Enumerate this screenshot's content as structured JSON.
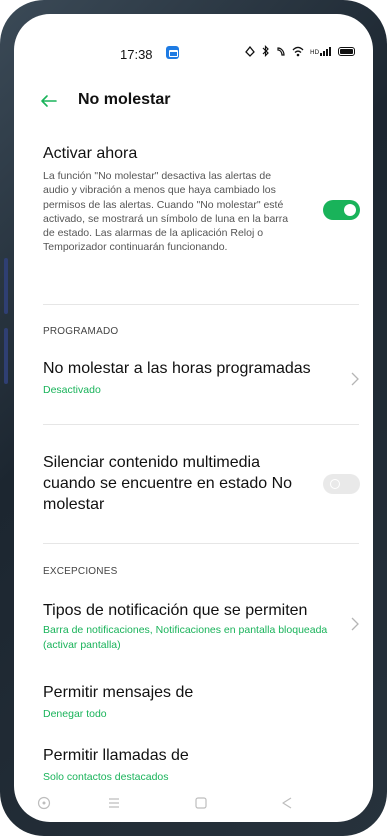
{
  "status_bar": {
    "time": "17:38",
    "icons": [
      "alarm-icon",
      "bluetooth-icon",
      "vibrate-icon",
      "wifi-icon",
      "signal-icon",
      "battery-icon"
    ]
  },
  "header": {
    "title": "No molestar",
    "back_icon": "back-arrow-icon"
  },
  "main": {
    "activate_now": {
      "title": "Activar ahora",
      "description": "La función \"No molestar\" desactiva las alertas de audio y vibración a menos que haya cambiado los permisos de las alertas. Cuando \"No molestar\" esté activado, se mostrará un símbolo de luna en la barra de estado. Las alarmas de la aplicación Reloj o Temporizador continuarán funcionando.",
      "toggle_on": true
    },
    "scheduled_section_label": "PROGRAMADO",
    "scheduled": {
      "title": "No molestar a las horas programadas",
      "status": "Desactivado"
    },
    "mute_media": {
      "title": "Silenciar contenido multimedia cuando se encuentre en estado No molestar",
      "toggle_on": false
    },
    "exceptions_section_label": "EXCEPCIONES",
    "notification_types": {
      "title": "Tipos de notificación que se permiten",
      "status": "Barra de notificaciones, Notificaciones en pantalla bloqueada (activar pantalla)"
    },
    "allow_messages": {
      "title": "Permitir mensajes de",
      "status": "Denegar todo"
    },
    "allow_calls": {
      "title": "Permitir llamadas de",
      "status": "Solo contactos destacados"
    }
  },
  "nav_bar": {
    "icons": [
      "assistant-icon",
      "menu-icon",
      "home-icon",
      "back-icon"
    ]
  },
  "colors": {
    "accent": "#19b35a",
    "toggle_off": "#e9e9e9",
    "device_frame": "#1c2630"
  }
}
